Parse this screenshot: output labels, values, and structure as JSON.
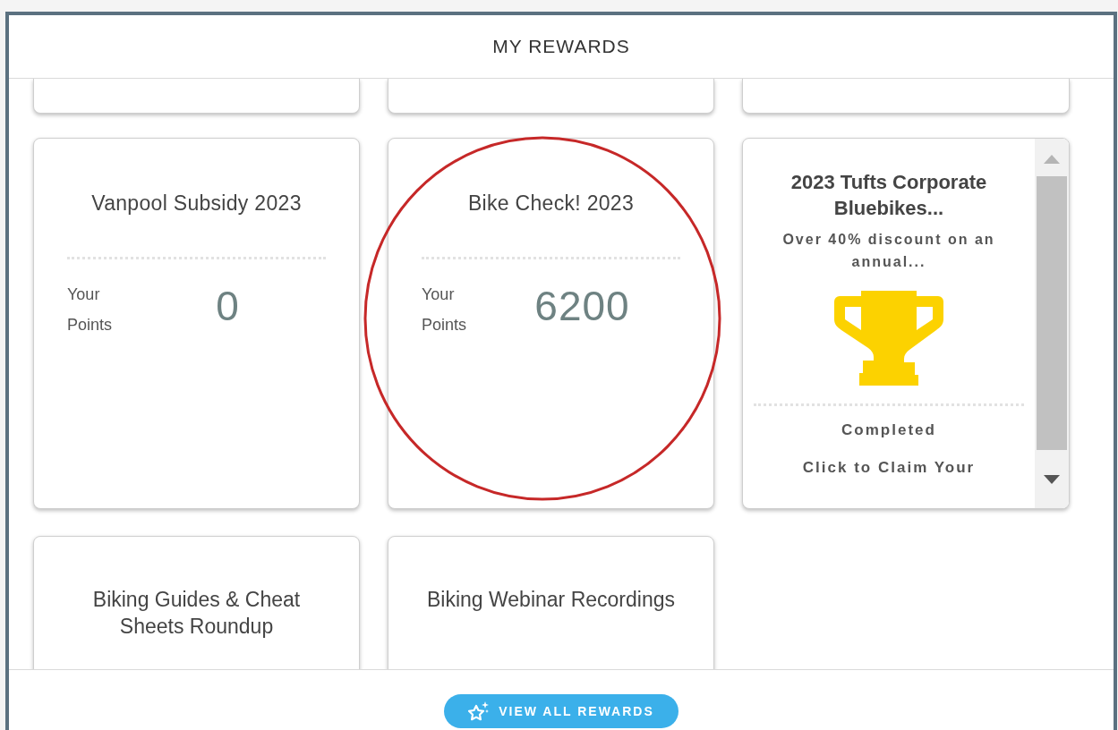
{
  "header": {
    "title": "MY REWARDS"
  },
  "rewards": [
    {
      "kind": "points",
      "title": "Vanpool Subsidy 2023",
      "points_label": "Your Points",
      "points": "0",
      "highlighted": false
    },
    {
      "kind": "points",
      "title": "Bike Check! 2023",
      "points_label": "Your Points",
      "points": "6200",
      "highlighted": true
    },
    {
      "kind": "claim",
      "title": "2023 Tufts Corporate Bluebikes...",
      "description": "Over 40% discount on an annual...",
      "status": "Completed",
      "action": "Click to Claim Your"
    },
    {
      "kind": "title",
      "title": "Biking Guides & Cheat Sheets Roundup"
    },
    {
      "kind": "title",
      "title": "Biking Webinar Recordings"
    }
  ],
  "footer": {
    "button": "VIEW ALL REWARDS"
  }
}
